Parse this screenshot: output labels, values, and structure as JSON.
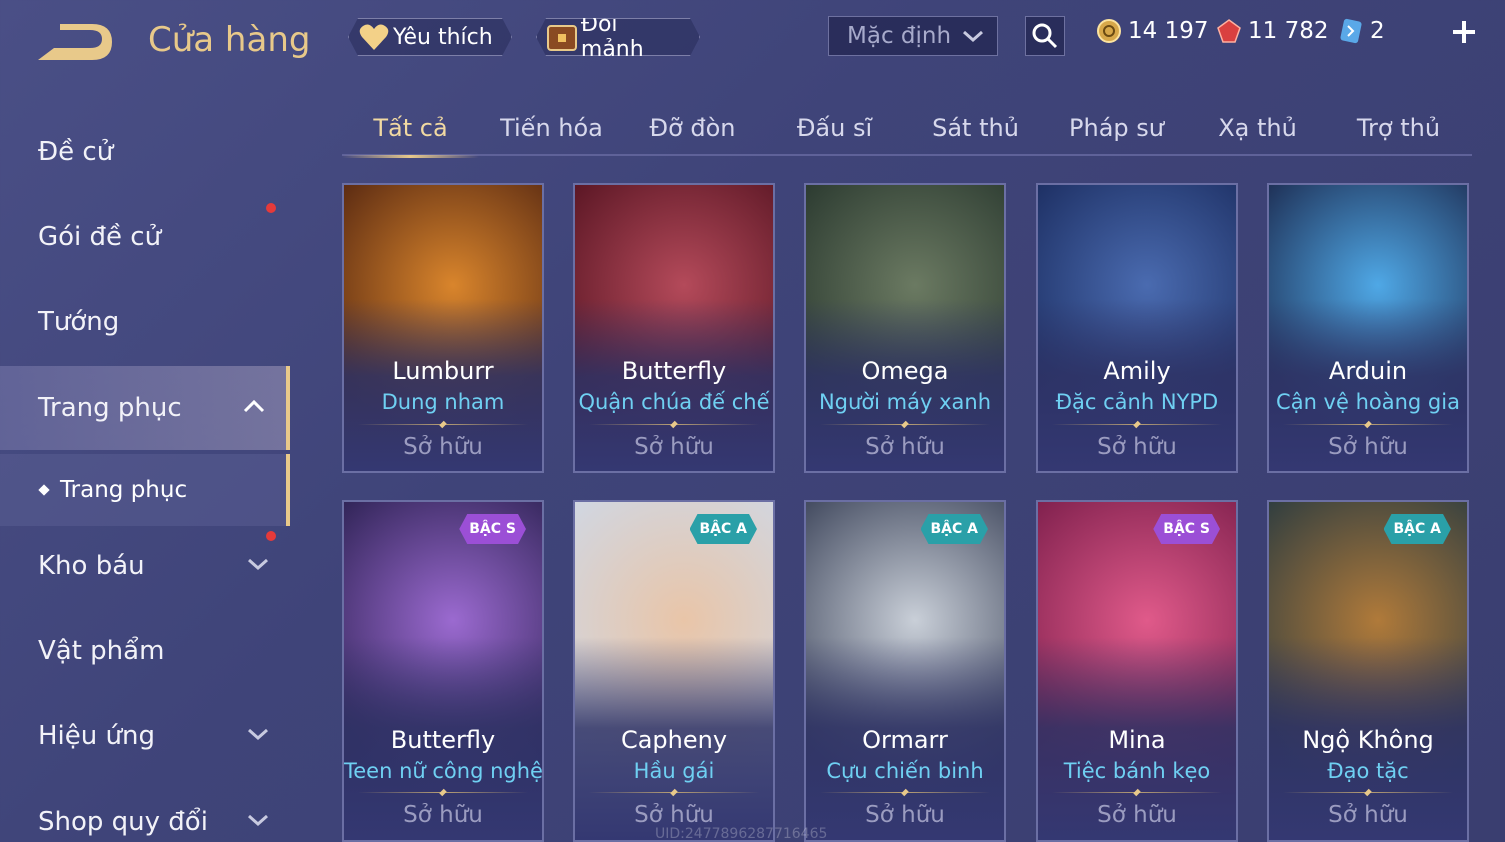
{
  "header": {
    "title": "Cửa hàng",
    "favorite_label": "Yêu thích",
    "exchange_label": "Đổi mảnh",
    "sort_value": "Mặc định",
    "gold": "14 197",
    "gems": "11 782",
    "tickets": "2"
  },
  "sidebar": {
    "items": [
      {
        "label": "Đề cử"
      },
      {
        "label": "Gói đề cử"
      },
      {
        "label": "Tướng"
      },
      {
        "label": "Trang phục"
      },
      {
        "label": "Kho báu"
      },
      {
        "label": "Vật phẩm"
      },
      {
        "label": "Hiệu ứng"
      },
      {
        "label": "Shop quy đổi"
      }
    ],
    "sub_item": "Trang phục"
  },
  "tabs": [
    "Tất cả",
    "Tiến hóa",
    "Đỡ đòn",
    "Đấu sĩ",
    "Sát thủ",
    "Pháp sư",
    "Xạ thủ",
    "Trợ thủ"
  ],
  "cards": [
    {
      "hero": "Lumburr",
      "skin": "Dung nham",
      "status": "Sở hữu",
      "tier": "",
      "palette": [
        "#5a2a12",
        "#d9852c"
      ]
    },
    {
      "hero": "Butterfly",
      "skin": "Quận chúa đế chế",
      "status": "Sở hữu",
      "tier": "",
      "palette": [
        "#5a1624",
        "#b44a5a"
      ]
    },
    {
      "hero": "Omega",
      "skin": "Người máy xanh",
      "status": "Sở hữu",
      "tier": "",
      "palette": [
        "#2b3a30",
        "#6b7a62"
      ]
    },
    {
      "hero": "Amily",
      "skin": "Đặc cảnh NYPD",
      "status": "Sở hữu",
      "tier": "",
      "palette": [
        "#1d2f63",
        "#4a6bb0"
      ]
    },
    {
      "hero": "Arduin",
      "skin": "Cận vệ hoàng gia",
      "status": "Sở hữu",
      "tier": "",
      "palette": [
        "#1e2f55",
        "#4fa8e6"
      ]
    },
    {
      "hero": "Butterfly",
      "skin": "Teen nữ công nghệ",
      "status": "Sở hữu",
      "tier": "BẬC S",
      "palette": [
        "#2a2050",
        "#9b6ad0"
      ]
    },
    {
      "hero": "Capheny",
      "skin": "Hầu gái",
      "status": "Sở hữu",
      "tier": "BẬC A",
      "palette": [
        "#cfd8e6",
        "#e9c5a8"
      ]
    },
    {
      "hero": "Ormarr",
      "skin": "Cựu chiến binh",
      "status": "Sở hữu",
      "tier": "BẬC A",
      "palette": [
        "#3a4258",
        "#c9cfd8"
      ]
    },
    {
      "hero": "Mina",
      "skin": "Tiệc bánh kẹo",
      "status": "Sở hữu",
      "tier": "BẬC S",
      "palette": [
        "#7a1d4a",
        "#e05a8a"
      ]
    },
    {
      "hero": "Ngộ Không",
      "skin": "Đạo tặc",
      "status": "Sở hữu",
      "tier": "BẬC A",
      "palette": [
        "#283a40",
        "#b07a3a"
      ]
    }
  ],
  "colors": {
    "accent": "#e8c98a",
    "skin_name": "#6fd0f2",
    "tier_s": "#9b4fd6",
    "tier_a": "#2aa0a8"
  },
  "footer_uid": "UID:2477896287716465"
}
